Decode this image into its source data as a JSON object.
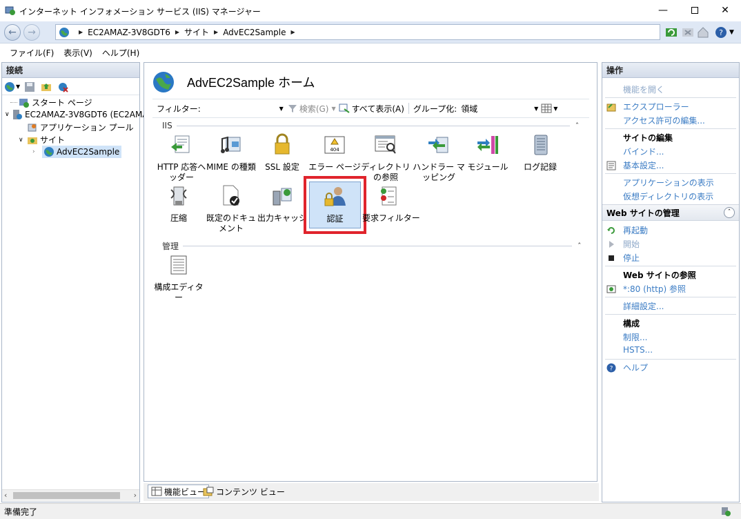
{
  "window": {
    "title": "インターネット インフォメーション サービス (IIS) マネージャー"
  },
  "address": {
    "crumbs": [
      "EC2AMAZ-3V8GDT6",
      "サイト",
      "AdvEC2Sample"
    ]
  },
  "menu": [
    "ファイル(F)",
    "表示(V)",
    "ヘルプ(H)"
  ],
  "connections": {
    "header": "接続",
    "tree": [
      "スタート ページ",
      "EC2AMAZ-3V8GDT6 (EC2AMA",
      "アプリケーション プール",
      "サイト",
      "AdvEC2Sample"
    ]
  },
  "center": {
    "title": "AdvEC2Sample ホーム",
    "filter_label": "フィルター:",
    "search_label": "検索(G)",
    "show_all_label": "すべて表示(A)",
    "group_label": "グループ化:",
    "group_value": "領域",
    "group_iis": "IIS",
    "group_manage": "管理",
    "features_iis": [
      "HTTP 応答ヘッダー",
      "MIME の種類",
      "SSL 設定",
      "エラー ページ",
      "ディレクトリの参照",
      "ハンドラー マッピング",
      "モジュール",
      "ログ記録",
      "圧縮",
      "既定のドキュメント",
      "出力キャッシュ",
      "認証",
      "要求フィルター"
    ],
    "features_manage": [
      "構成エディター"
    ]
  },
  "bottom_tabs": {
    "feature_view": "機能ビュー",
    "content_view": "コンテンツ ビュー"
  },
  "actions": {
    "header": "操作",
    "open_feature": "機能を開く",
    "explore": "エクスプローラー",
    "edit_permissions": "アクセス許可の編集...",
    "edit_site": "サイトの編集",
    "bindings": "バインド...",
    "basic_settings": "基本設定...",
    "view_applications": "アプリケーションの表示",
    "view_vdirs": "仮想ディレクトリの表示",
    "manage_site": "Web サイトの管理",
    "restart": "再起動",
    "start": "開始",
    "stop": "停止",
    "browse_site": "Web サイトの参照",
    "browse_80": "*:80 (http) 参照",
    "advanced": "詳細設定...",
    "configure": "構成",
    "limits": "制限...",
    "hsts": "HSTS...",
    "help": "ヘルプ"
  },
  "status": {
    "text": "準備完了"
  },
  "colors": {
    "highlight_box": "#e0242c",
    "link": "#3b7cc4",
    "selection": "#cfe3f8"
  }
}
